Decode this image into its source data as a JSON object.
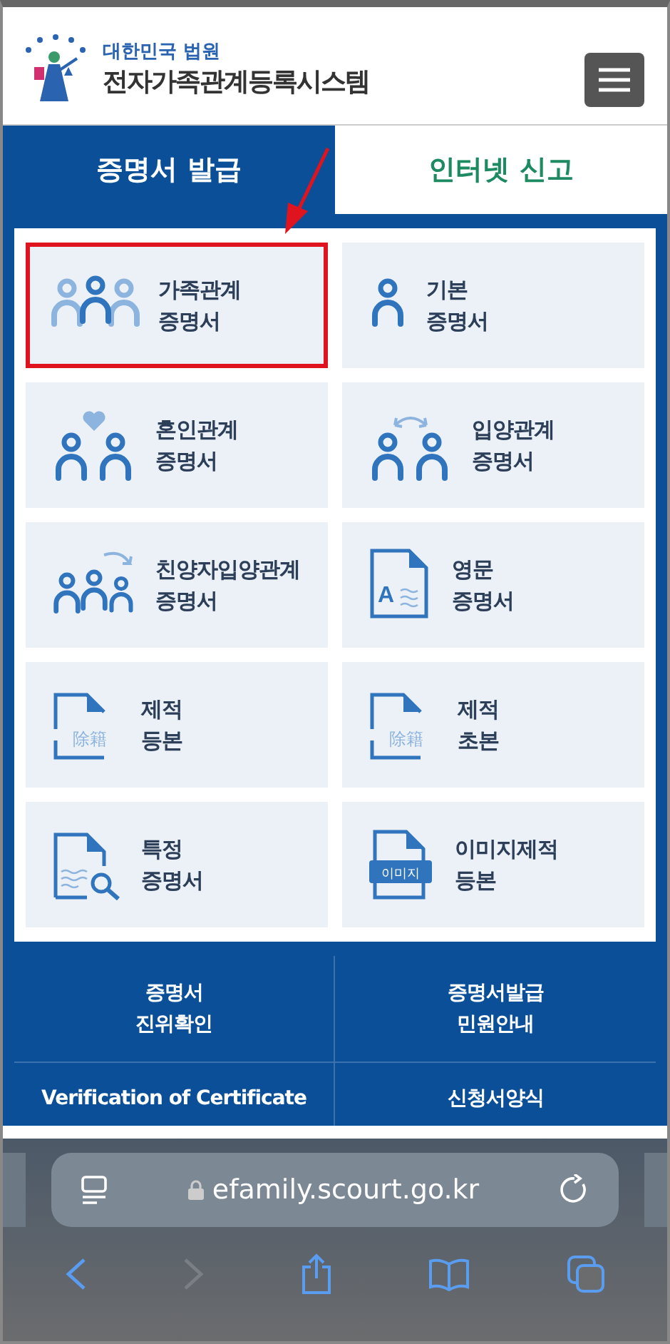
{
  "header": {
    "subtitle": "대한민국 법원",
    "title": "전자가족관계등록시스템"
  },
  "tabs": [
    {
      "label": "증명서 발급",
      "selected": true
    },
    {
      "label": "인터넷 신고",
      "selected": false
    }
  ],
  "cards": [
    {
      "kind": "family",
      "lines": [
        "가족관계",
        "증명서"
      ],
      "highlighted": true
    },
    {
      "kind": "person",
      "lines": [
        "기본",
        "증명서"
      ],
      "highlighted": false
    },
    {
      "kind": "marriage",
      "lines": [
        "혼인관계",
        "증명서"
      ],
      "highlighted": false
    },
    {
      "kind": "adoption",
      "lines": [
        "입양관계",
        "증명서"
      ],
      "highlighted": false
    },
    {
      "kind": "child-adoption",
      "lines": [
        "친양자입양관계",
        "증명서"
      ],
      "highlighted": false
    },
    {
      "kind": "english",
      "icon_text": "A",
      "lines": [
        "영문",
        "증명서"
      ],
      "highlighted": false
    },
    {
      "kind": "removed",
      "icon_text": "除籍",
      "lines": [
        "제적",
        "등본"
      ],
      "highlighted": false
    },
    {
      "kind": "removed",
      "icon_text": "除籍",
      "lines": [
        "제적",
        "초본"
      ],
      "highlighted": false
    },
    {
      "kind": "search-doc",
      "lines": [
        "특정",
        "증명서"
      ],
      "highlighted": false
    },
    {
      "kind": "image",
      "icon_text": "이미지",
      "lines": [
        "이미지제적",
        "등본"
      ],
      "highlighted": false
    }
  ],
  "links": [
    {
      "lines": [
        "증명서",
        "진위확인"
      ]
    },
    {
      "lines": [
        "증명서발급",
        "민원안내"
      ]
    },
    {
      "lines": [
        "Verification of Certificate"
      ]
    },
    {
      "lines": [
        "신청서양식"
      ]
    }
  ],
  "browser": {
    "url": "efamily.scourt.go.kr"
  }
}
